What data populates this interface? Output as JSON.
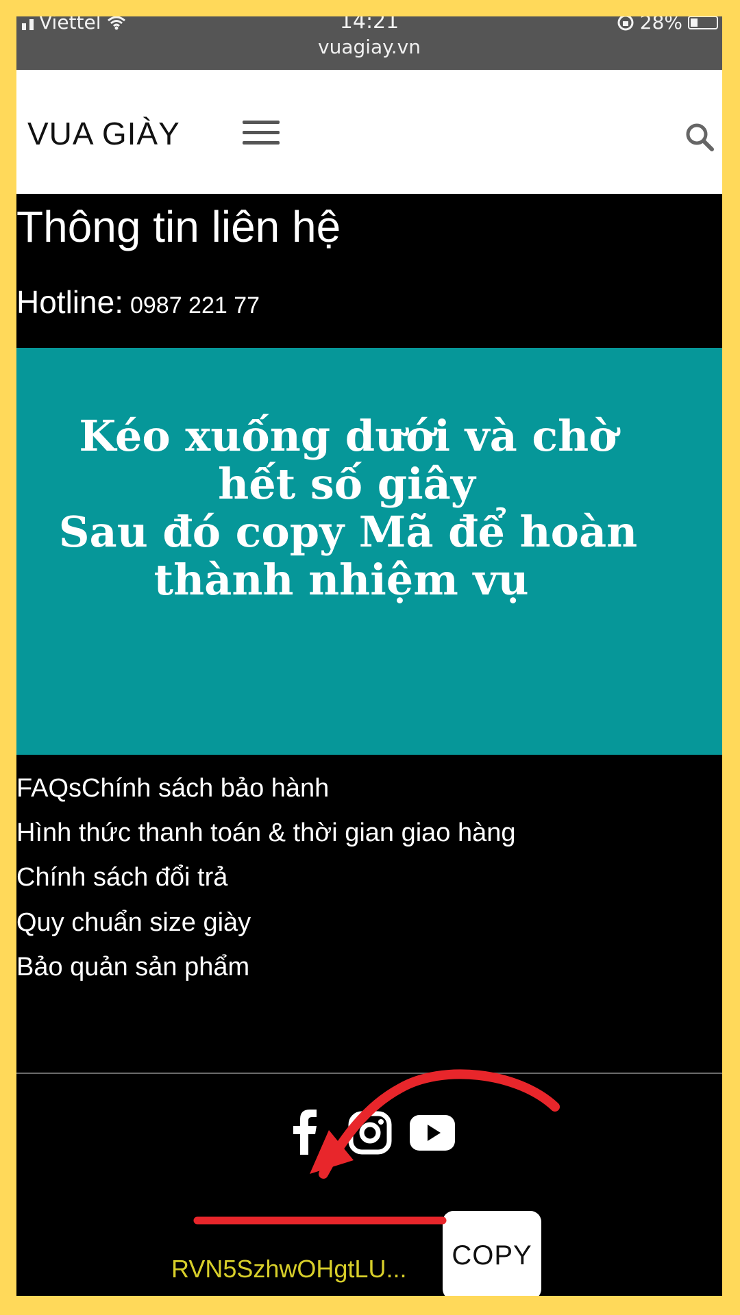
{
  "status_bar": {
    "carrier": "Viettel",
    "time": "14:21",
    "battery": "28%",
    "url": "vuagiay.vn"
  },
  "header": {
    "logo": "VUA GIÀY",
    "menu_icon": "hamburger-menu-icon",
    "search_icon": "search-icon"
  },
  "contact": {
    "title": "Thông tin liên hệ",
    "hotline_label": "Hotline:",
    "hotline_number": "0987 221 77"
  },
  "banner": {
    "lines": [
      "Kéo xuống dưới và chờ",
      "hết số giây",
      "Sau đó copy Mã để hoàn",
      "thành nhiệm vụ"
    ],
    "background": "#069799"
  },
  "footer_links": [
    "FAQsChính sách bảo hành",
    "Hình thức thanh toán & thời gian giao hàng",
    "Chính sách đổi trả",
    "Quy chuẩn size giày",
    "Bảo quản sản phẩm"
  ],
  "social": [
    "facebook-icon",
    "instagram-icon",
    "youtube-icon"
  ],
  "code": {
    "value": "RVN5SzhwOHgtLU...",
    "copy_label": "COPY",
    "color": "#D8CF2A"
  },
  "colors": {
    "border": "#FFD95A",
    "annotation": "#E8262B",
    "page_bg": "#000000"
  }
}
